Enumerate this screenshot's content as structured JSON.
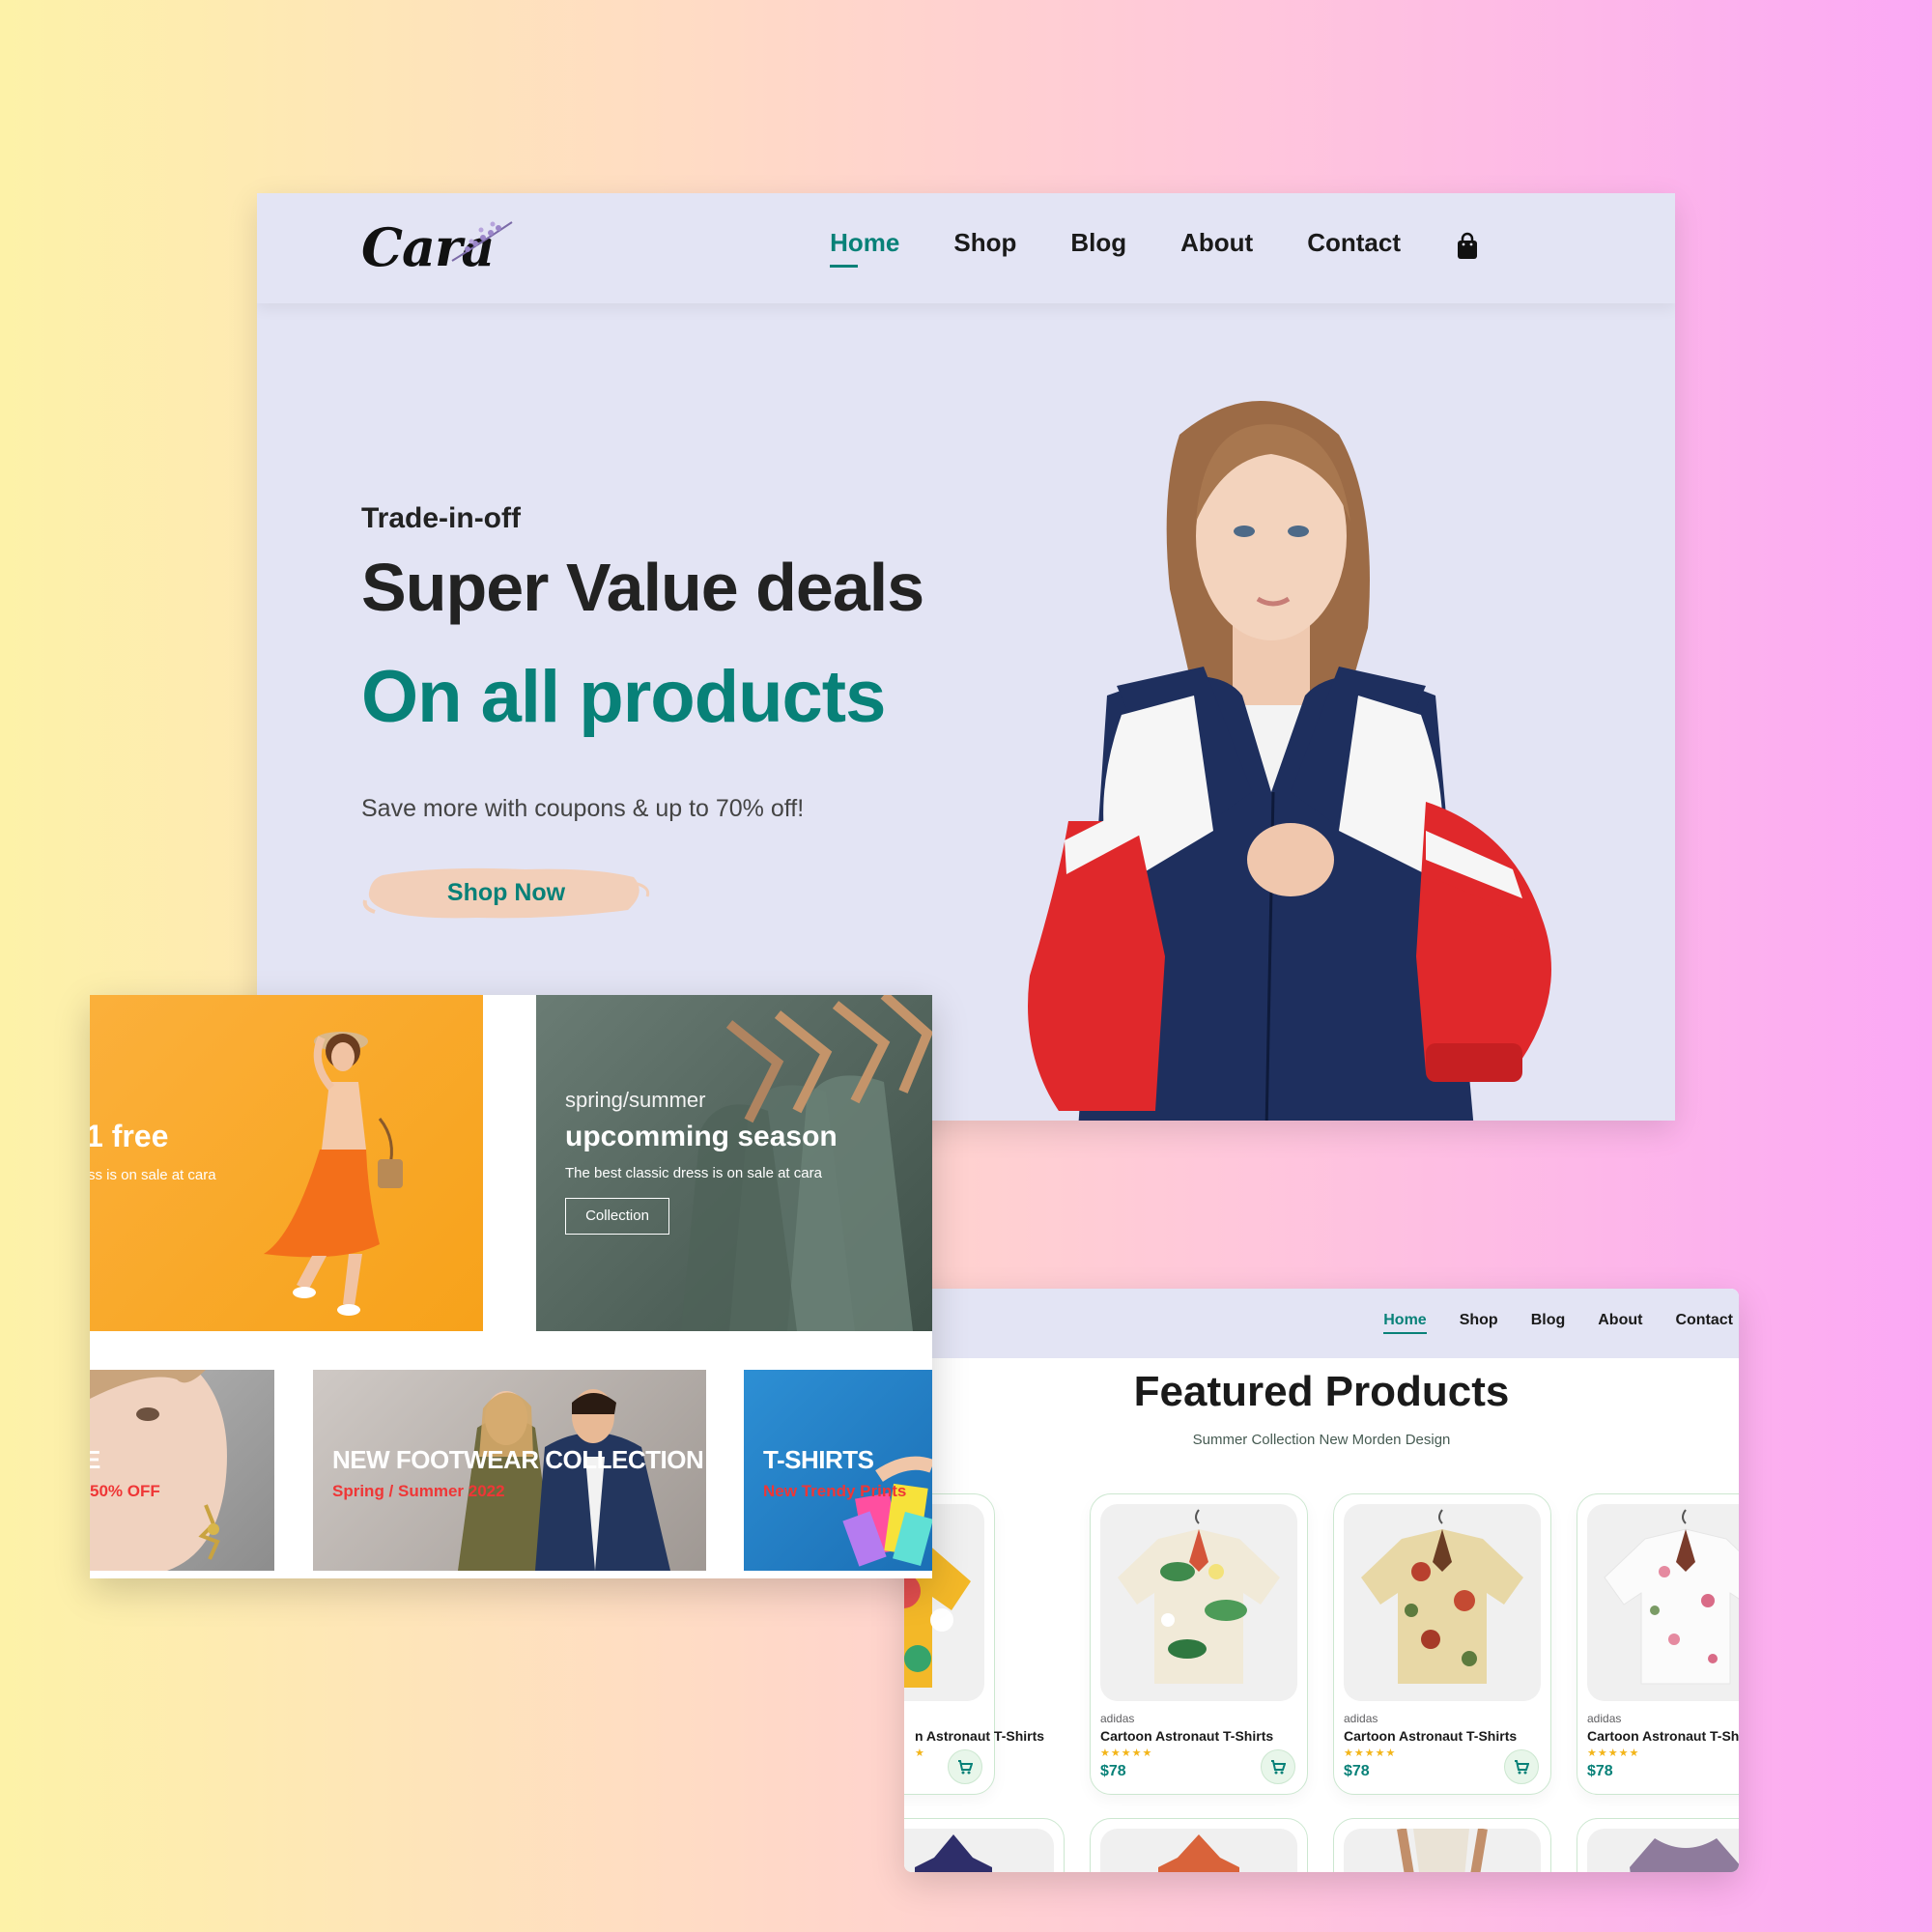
{
  "hero": {
    "logo": "Cara",
    "nav": [
      "Home",
      "Shop",
      "Blog",
      "About",
      "Contact"
    ],
    "eyebrow": "Trade-in-off",
    "title": "Super Value deals",
    "highlight": "On all products",
    "subtitle": "Save more with coupons & up to 70% off!",
    "cta": "Shop Now",
    "cart_icon": "shopping-bag-icon"
  },
  "banners": {
    "orange": {
      "title": "1 free",
      "text": "ss is on sale at cara"
    },
    "season": {
      "eyebrow": "spring/summer",
      "title": "upcomming season",
      "text": "The best classic dress is on sale at cara",
      "button": "Collection"
    },
    "grey": {
      "title": "E",
      "text": "50% OFF"
    },
    "footwear": {
      "title": "NEW FOOTWEAR COLLECTION",
      "text": "Spring / Summer 2022"
    },
    "tshirts": {
      "title": "T-SHIRTS",
      "text": "New Trendy Prints"
    }
  },
  "featured": {
    "nav": [
      "Home",
      "Shop",
      "Blog",
      "About",
      "Contact"
    ],
    "title": "Featured Products",
    "subtitle": "Summer Collection New Morden Design",
    "products": [
      {
        "brand": "",
        "name": "n Astronaut T-Shirts",
        "stars": "★",
        "price": ""
      },
      {
        "brand": "adidas",
        "name": "Cartoon Astronaut T-Shirts",
        "stars": "★★★★★",
        "price": "$78"
      },
      {
        "brand": "adidas",
        "name": "Cartoon Astronaut T-Shirts",
        "stars": "★★★★★",
        "price": "$78"
      },
      {
        "brand": "adidas",
        "name": "Cartoon Astronaut T-Sh",
        "stars": "★★★★★",
        "price": "$78"
      }
    ]
  },
  "colors": {
    "brand_green": "#088178",
    "nav_bg": "#e3e4f4",
    "star": "#f3b519",
    "sale_red": "#ef3636"
  }
}
